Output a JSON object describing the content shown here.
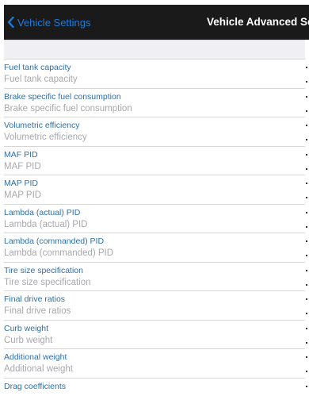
{
  "nav": {
    "back_label": "Vehicle Settings",
    "title": "Vehicle Advanced Se"
  },
  "rows": [
    {
      "title": "Fuel tank capacity",
      "subtitle": "Fuel tank capacity"
    },
    {
      "title": "Brake specific fuel consumption",
      "subtitle": "Brake specific fuel consumption"
    },
    {
      "title": "Volumetric efficiency",
      "subtitle": "Volumetric efficiency"
    },
    {
      "title": "MAF PID",
      "subtitle": "MAF PID"
    },
    {
      "title": "MAP PID",
      "subtitle": "MAP PID"
    },
    {
      "title": "Lambda (actual) PID",
      "subtitle": "Lambda (actual) PID"
    },
    {
      "title": "Lambda (commanded) PID",
      "subtitle": "Lambda (commanded) PID"
    },
    {
      "title": "Tire size specification",
      "subtitle": "Tire size specification"
    },
    {
      "title": "Final drive ratios",
      "subtitle": "Final drive ratios"
    },
    {
      "title": "Curb weight",
      "subtitle": "Curb weight"
    },
    {
      "title": "Additional weight",
      "subtitle": "Additional weight"
    },
    {
      "title": "Drag coefficients",
      "subtitle": ""
    }
  ],
  "colors": {
    "navbar_bg": "#1a1a1a",
    "back_accent": "#1f7cd9",
    "row_title": "#2f6fa6",
    "row_subtitle": "#a9a9ad",
    "section_bg": "#efeff4"
  },
  "icons": {
    "back": "chevron-left-icon"
  }
}
